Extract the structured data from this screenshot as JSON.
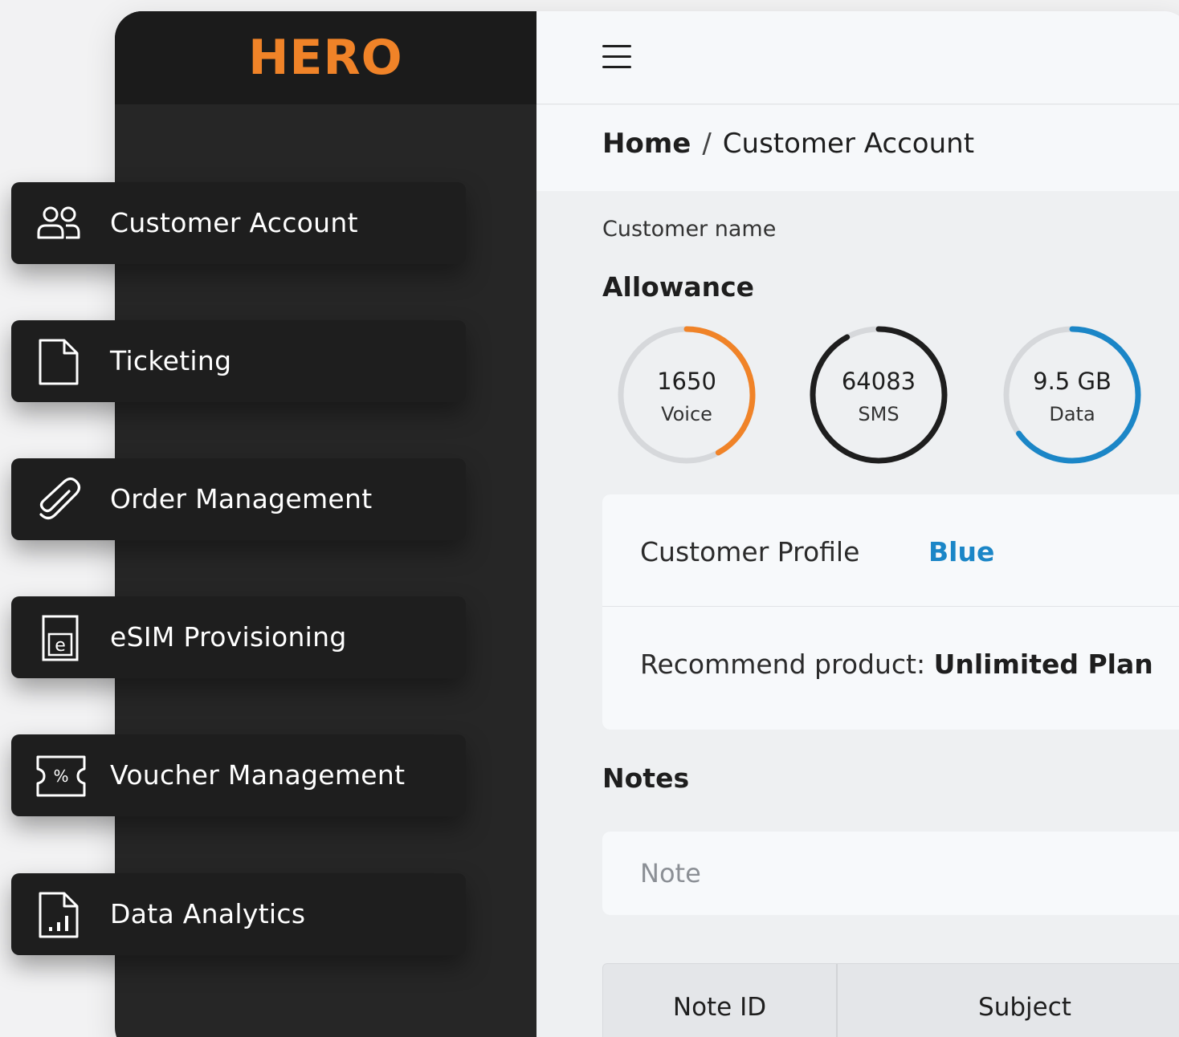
{
  "brand": {
    "logo_text": "HERO",
    "accent": "#f08328"
  },
  "nav": {
    "items": [
      {
        "label": "Customer Account",
        "icon": "users-icon"
      },
      {
        "label": "Ticketing",
        "icon": "document-icon"
      },
      {
        "label": "Order Management",
        "icon": "paperclip-icon"
      },
      {
        "label": "eSIM Provisioning",
        "icon": "esim-icon"
      },
      {
        "label": "Voucher Management",
        "icon": "voucher-icon"
      },
      {
        "label": "Data Analytics",
        "icon": "analytics-icon"
      }
    ]
  },
  "breadcrumb": {
    "home": "Home",
    "separator": "/",
    "current": "Customer Account"
  },
  "customer": {
    "name_label": "Customer name"
  },
  "allowance": {
    "title": "Allowance",
    "gauges": [
      {
        "value": "1650",
        "label": "Voice",
        "fraction": 0.42,
        "color": "#f08328"
      },
      {
        "value": "64083",
        "label": "SMS",
        "fraction": 0.92,
        "color": "#1e1e1e"
      },
      {
        "value": "9.5 GB",
        "label": "Data",
        "fraction": 0.65,
        "color": "#1b86c7"
      }
    ]
  },
  "profile": {
    "label": "Customer Profile",
    "value": "Blue",
    "value_color": "#1b86c7",
    "recommend_label": "Recommend product:",
    "recommend_value": "Unlimited Plan"
  },
  "notes": {
    "title": "Notes",
    "placeholder": "Note",
    "table_headers": {
      "id": "Note ID",
      "subject": "Subject"
    }
  }
}
